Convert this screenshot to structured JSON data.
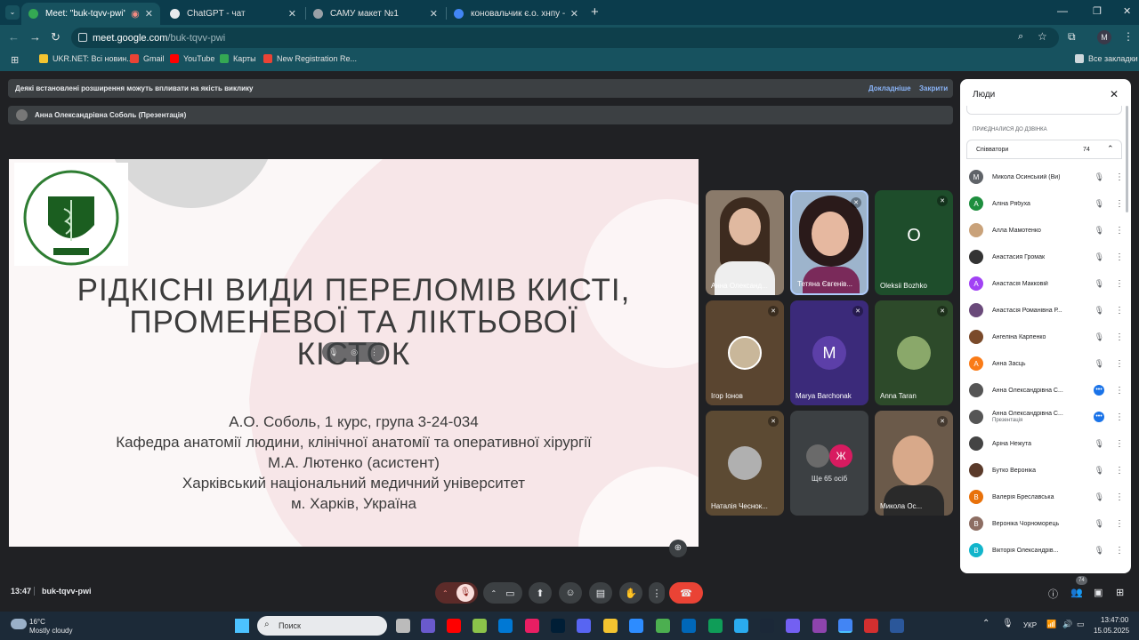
{
  "tabs": [
    {
      "title": "Meet: \"buk-tqvv-pwi\"",
      "color": "#34a853"
    },
    {
      "title": "ChatGPT - чат",
      "color": "#e8eaed"
    },
    {
      "title": "САМУ макет №1",
      "color": "#9aa0a6"
    },
    {
      "title": "коновальчик є.о. хнпу - Пошук",
      "color": "#4285f4"
    }
  ],
  "url": {
    "host": "meet.google.com",
    "path": "/buk-tqvv-pwi"
  },
  "bookmarks": [
    "UKR.NET: Всі новин...",
    "Gmail",
    "YouTube",
    "Карты",
    "New Registration Re..."
  ],
  "bookmarks_all": "Все закладки",
  "profile_initial": "M",
  "banner": {
    "text": "Деякі встановлені розширення можуть впливати на якість виклику",
    "details": "Докладніше",
    "close": "Закрити"
  },
  "presenter_bar": "Анна Олександрівна Соболь (Презентація)",
  "slide": {
    "title": [
      "РІДКІСНІ ВИДИ ПЕРЕЛОМІВ КИСТІ,",
      "ПРОМЕНЕВОЇ ТА ЛІКТЬОВОЇ",
      "КІСТОК"
    ],
    "lines": [
      "А.О. Соболь, 1 курс, група 3-24-034",
      "Кафедра анатомії людини, клінічної анатомії та оперативної хірургії",
      "М.А. Лютенко (асистент)",
      "Харківський національний медичний університет",
      "м. Харків, Україна"
    ]
  },
  "tiles": [
    {
      "name": "Анна Олександ...",
      "bg": "#8a7a6a",
      "letter": ""
    },
    {
      "name": "Тетяна Євгенів...",
      "bg": "#7a8aa0",
      "letter": ""
    },
    {
      "name": "Oleksii Bozhko",
      "bg": "#1e4d2b",
      "letter": "O"
    },
    {
      "name": "Ігор Іонов",
      "bg": "#5a4530",
      "letter": ""
    },
    {
      "name": "Marya Barchonak",
      "bg": "#3b2a7a",
      "letter": "M"
    },
    {
      "name": "Anna Taran",
      "bg": "#2d4a2a",
      "letter": ""
    },
    {
      "name": "Наталія Чеснок...",
      "bg": "#5c4a33",
      "letter": ""
    },
    {
      "name": "Ще 65 осіб",
      "bg": "#3c4043",
      "letter": ""
    },
    {
      "name": "Микола Ос...",
      "bg": "#6b5a4a",
      "letter": ""
    }
  ],
  "people": {
    "title": "Люди",
    "section": "ПРИЄДНАЛИСЯ ДО ДЗВІНКА",
    "group": "Співватори",
    "count": "74",
    "list": [
      {
        "name": "Микола Осинський (Ви)",
        "initial": "М",
        "color": "#5f6368"
      },
      {
        "name": "Аліна Рябуха",
        "initial": "А",
        "color": "#1e8e3e"
      },
      {
        "name": "Алла Мамотенко",
        "initial": "",
        "color": "#c9a27a"
      },
      {
        "name": "Анастасия Громак",
        "initial": "",
        "color": "#333333"
      },
      {
        "name": "Анастасія Макковій",
        "initial": "А",
        "color": "#a142f4"
      },
      {
        "name": "Анастасія Романівна Р...",
        "initial": "",
        "color": "#6a4a7a"
      },
      {
        "name": "Ангеліна Карпенко",
        "initial": "",
        "color": "#7a4a2a"
      },
      {
        "name": "Анна Засць",
        "initial": "А",
        "color": "#fa7b17"
      },
      {
        "name": "Анна Олександрівна С...",
        "initial": "",
        "color": "#555555"
      },
      {
        "name": "Анна Олександрівна С...",
        "initial": "",
        "color": "#555555",
        "sub": "Презентація"
      },
      {
        "name": "Аріна Нежута",
        "initial": "",
        "color": "#444444"
      },
      {
        "name": "Бутко Вероніка",
        "initial": "",
        "color": "#5a3a2a"
      },
      {
        "name": "Валерія Бреславська",
        "initial": "В",
        "color": "#e8710a"
      },
      {
        "name": "Вероніка Чорноморець",
        "initial": "В",
        "color": "#8d6e63"
      },
      {
        "name": "Вікторія Олександрів...",
        "initial": "В",
        "color": "#12b5cb"
      }
    ]
  },
  "bottom": {
    "time": "13:47",
    "code": "buk-tqvv-pwi",
    "people_badge": "74"
  },
  "taskbar": {
    "temp": "16°C",
    "weather": "Mostly cloudy",
    "search": "Поиск",
    "lang": "УКР",
    "clock": "13:47:00",
    "date": "15.05.2025"
  }
}
